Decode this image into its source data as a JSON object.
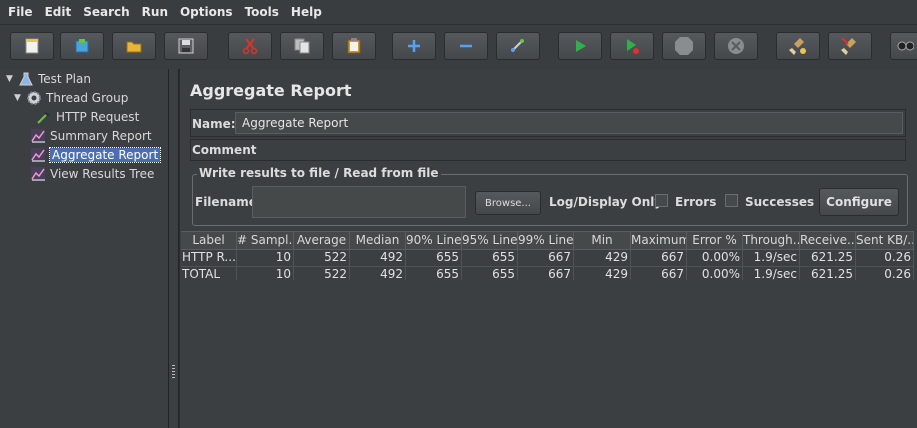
{
  "menu": [
    "File",
    "Edit",
    "Search",
    "Run",
    "Options",
    "Tools",
    "Help"
  ],
  "toolbar": {
    "icons": [
      "new-icon",
      "templates-icon",
      "open-icon",
      "save-icon",
      "cut-icon",
      "copy-icon",
      "paste-icon",
      "expand-icon",
      "collapse-icon",
      "toggle-icon",
      "start-icon",
      "start-no-pause-icon",
      "stop-icon",
      "shutdown-icon",
      "clear-icon",
      "clear-all-icon",
      "search-icon"
    ]
  },
  "tree": {
    "items": [
      {
        "label": "Test Plan",
        "icon": "flask-icon"
      },
      {
        "label": "Thread Group",
        "icon": "gear-icon"
      },
      {
        "label": "HTTP Request",
        "icon": "pipette-icon"
      },
      {
        "label": "Summary Report",
        "icon": "chart-icon"
      },
      {
        "label": "Aggregate Report",
        "icon": "chart-icon"
      },
      {
        "label": "View Results Tree",
        "icon": "chart-icon"
      }
    ]
  },
  "main": {
    "title": "Aggregate Report",
    "name_label": "Name:",
    "name_value": "Aggregate Report",
    "comments_label": "Comments:",
    "write_legend": "Write results to file / Read from file",
    "filename_label": "Filename",
    "browse_label": "Browse...",
    "log_display_label": "Log/Display Only:",
    "errors_label": "Errors",
    "successes_label": "Successes",
    "configure_label": "Configure"
  },
  "table": {
    "headers": [
      "Label",
      "# Sampl...",
      "Average",
      "Median",
      "90% Line",
      "95% Line",
      "99% Line",
      "Min",
      "Maximum",
      "Error %",
      "Through...",
      "Receive...",
      "Sent KB/..."
    ],
    "rows": [
      [
        "HTTP R...",
        "10",
        "522",
        "492",
        "655",
        "655",
        "667",
        "429",
        "667",
        "0.00%",
        "1.9/sec",
        "621.25",
        "0.26"
      ],
      [
        "TOTAL",
        "10",
        "522",
        "492",
        "655",
        "655",
        "667",
        "429",
        "667",
        "0.00%",
        "1.9/sec",
        "621.25",
        "0.26"
      ]
    ]
  },
  "colors": {
    "selected": "#4b6eaf",
    "start_green": "#2fb14a",
    "cut_red": "#d9342b"
  }
}
